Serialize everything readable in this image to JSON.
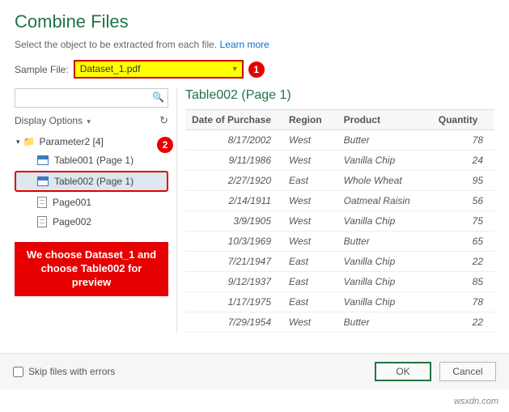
{
  "dialog": {
    "title": "Combine Files",
    "subtitle": "Select the object to be extracted from each file.",
    "learn_more": "Learn more",
    "sample_label": "Sample File:",
    "sample_value": "Dataset_1.pdf"
  },
  "badges": {
    "one": "1",
    "two": "2"
  },
  "sidebar": {
    "search_placeholder": "",
    "display_options": "Display Options",
    "root_label": "Parameter2 [4]",
    "items": [
      {
        "label": "Table001 (Page 1)",
        "type": "table",
        "selected": false
      },
      {
        "label": "Table002 (Page 1)",
        "type": "table",
        "selected": true
      },
      {
        "label": "Page001",
        "type": "page",
        "selected": false
      },
      {
        "label": "Page002",
        "type": "page",
        "selected": false
      }
    ],
    "note": "We choose Dataset_1 and choose Table002 for preview"
  },
  "preview": {
    "title": "Table002 (Page 1)",
    "columns": [
      "Date of Purchase",
      "Region",
      "Product",
      "Quantity"
    ],
    "rows": [
      [
        "8/17/2002",
        "West",
        "Butter",
        "78"
      ],
      [
        "9/11/1986",
        "West",
        "Vanilla Chip",
        "24"
      ],
      [
        "2/27/1920",
        "East",
        "Whole Wheat",
        "95"
      ],
      [
        "2/14/1911",
        "West",
        "Oatmeal Raisin",
        "56"
      ],
      [
        "3/9/1905",
        "West",
        "Vanilla Chip",
        "75"
      ],
      [
        "10/3/1969",
        "West",
        "Butter",
        "65"
      ],
      [
        "7/21/1947",
        "East",
        "Vanilla Chip",
        "22"
      ],
      [
        "9/12/1937",
        "East",
        "Vanilla Chip",
        "85"
      ],
      [
        "1/17/1975",
        "East",
        "Vanilla Chip",
        "78"
      ],
      [
        "7/29/1954",
        "West",
        "Butter",
        "22"
      ]
    ]
  },
  "footer": {
    "skip_label": "Skip files with errors",
    "ok": "OK",
    "cancel": "Cancel"
  },
  "watermark": "wsxdn.com"
}
